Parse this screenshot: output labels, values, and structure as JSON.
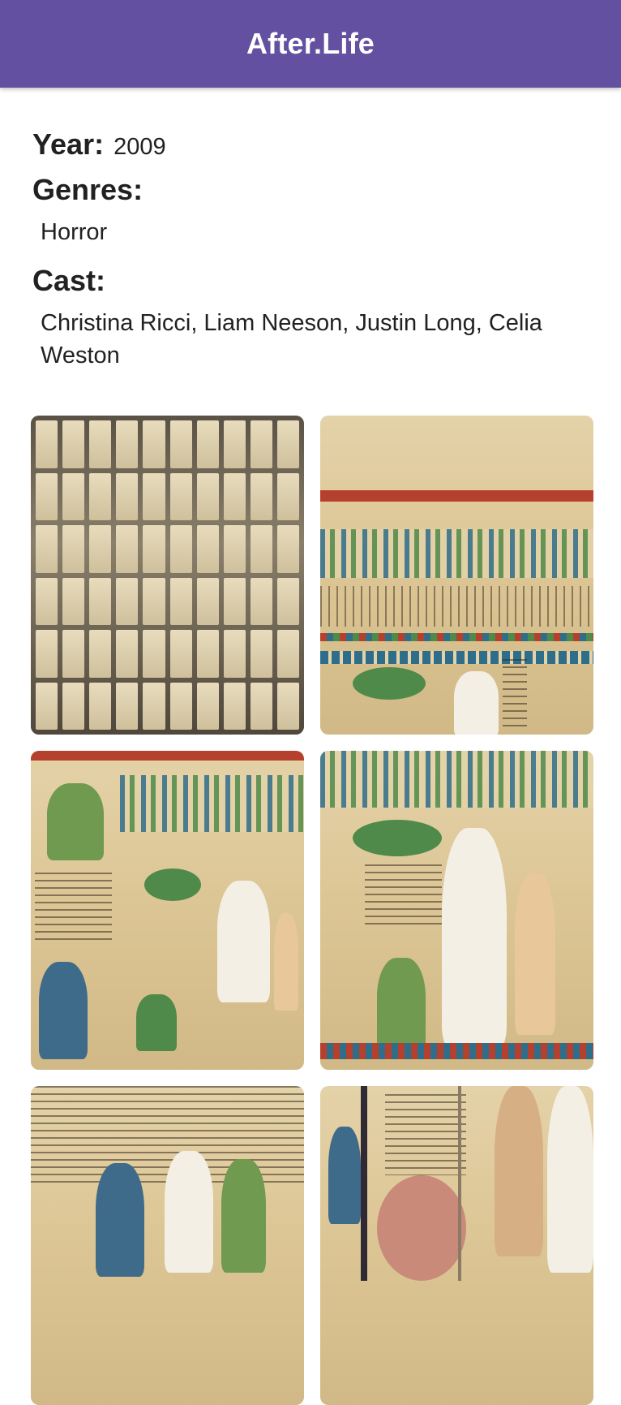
{
  "appbar": {
    "title": "After.Life",
    "color": "#6350a0"
  },
  "details": {
    "year_label": "Year:",
    "year_value": "2009",
    "genres_label": "Genres:",
    "genres_value": "Horror",
    "cast_label": "Cast:",
    "cast_value": "Christina Ricci, Liam Neeson, Justin Long, Celia Weston"
  },
  "gallery": {
    "images": [
      {
        "label": "niches"
      },
      {
        "label": "papyrus"
      },
      {
        "label": "papyrus"
      },
      {
        "label": "papyrus"
      },
      {
        "label": "papyrus"
      },
      {
        "label": "papyrus"
      }
    ]
  }
}
